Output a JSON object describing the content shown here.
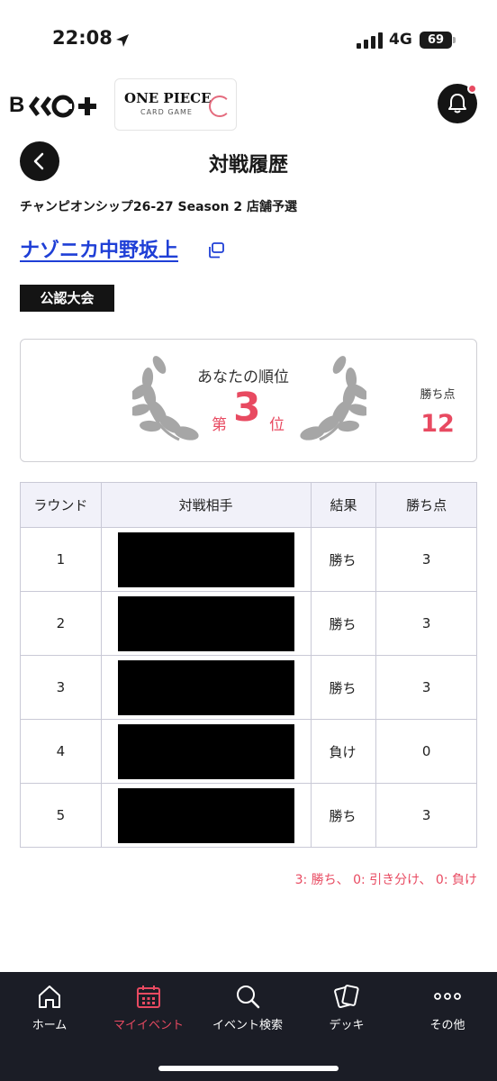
{
  "status_bar": {
    "time": "22:08",
    "network": "4G",
    "battery": "69"
  },
  "header": {
    "brand_logo": "BNGC+",
    "game_logo_title": "ONE PIECE",
    "game_logo_subtitle": "CARD GAME",
    "notification_icon": "bell-icon",
    "has_unread": true
  },
  "page": {
    "title": "対戦履歴",
    "event_name": "チャンピオンシップ26-27 Season 2 店舗予選",
    "store_name": "ナゾニカ中野坂上",
    "badge": "公認大会"
  },
  "rank": {
    "label": "あなたの順位",
    "prefix": "第",
    "value": "3",
    "suffix": "位",
    "points_label": "勝ち点",
    "points_value": "12"
  },
  "table": {
    "headers": [
      "ラウンド",
      "対戦相手",
      "結果",
      "勝ち点"
    ],
    "rows": [
      {
        "round": "1",
        "opponent": "",
        "result": "勝ち",
        "points": "3"
      },
      {
        "round": "2",
        "opponent": "",
        "result": "勝ち",
        "points": "3"
      },
      {
        "round": "3",
        "opponent": "",
        "result": "勝ち",
        "points": "3"
      },
      {
        "round": "4",
        "opponent": "",
        "result": "負け",
        "points": "0"
      },
      {
        "round": "5",
        "opponent": "",
        "result": "勝ち",
        "points": "3"
      }
    ]
  },
  "legend": "3: 勝ち、 0: 引き分け、 0: 負け",
  "nav": {
    "items": [
      {
        "label": "ホーム",
        "icon": "home-icon"
      },
      {
        "label": "マイイベント",
        "icon": "calendar-icon"
      },
      {
        "label": "イベント検索",
        "icon": "search-icon"
      },
      {
        "label": "デッキ",
        "icon": "cards-icon"
      },
      {
        "label": "その他",
        "icon": "more-icon"
      }
    ],
    "active_index": 1
  },
  "colors": {
    "accent": "#e84a61",
    "link": "#1f3fd6",
    "dark": "#141414",
    "nav_bg": "#1b1d26"
  }
}
